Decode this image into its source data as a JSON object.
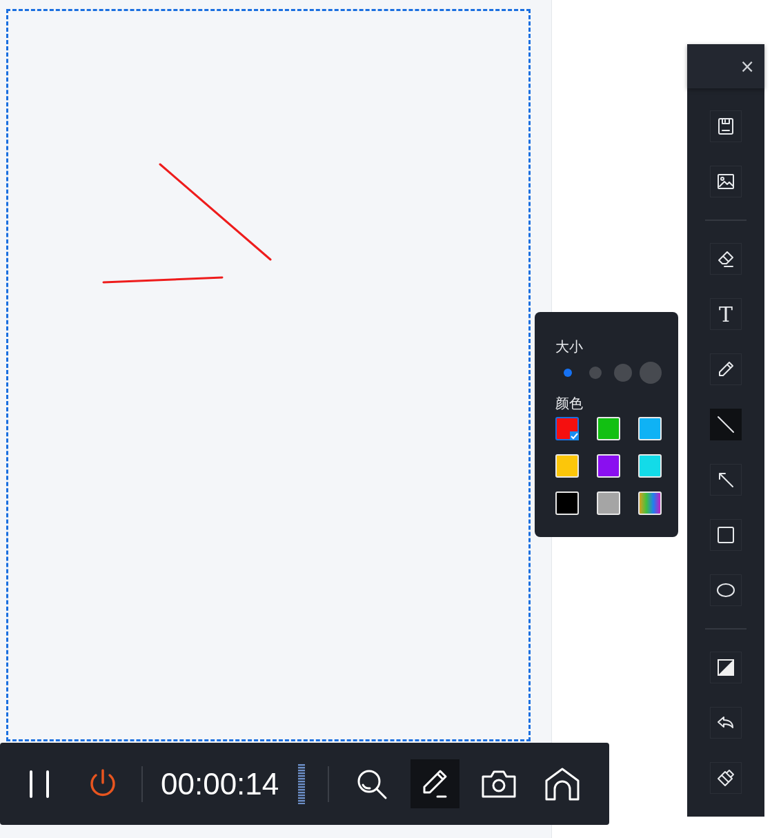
{
  "canvas": {
    "strokes": [
      {
        "kind": "line"
      },
      {
        "kind": "line"
      }
    ]
  },
  "side_toolbar": {
    "close": "×",
    "items": [
      {
        "kind": "save",
        "selected": false
      },
      {
        "kind": "image",
        "selected": false
      },
      {
        "kind": "divider"
      },
      {
        "kind": "eraser",
        "selected": false
      },
      {
        "kind": "text",
        "label": "T",
        "selected": false
      },
      {
        "kind": "pen",
        "selected": false
      },
      {
        "kind": "line",
        "selected": true
      },
      {
        "kind": "arrow",
        "selected": false
      },
      {
        "kind": "rect",
        "selected": false
      },
      {
        "kind": "ellipse",
        "selected": false
      },
      {
        "kind": "divider"
      },
      {
        "kind": "fill",
        "selected": false
      },
      {
        "kind": "undo",
        "selected": false
      },
      {
        "kind": "clear",
        "selected": false
      }
    ]
  },
  "style_popup": {
    "size_label": "大小",
    "sizes": [
      {
        "selected": true
      },
      {
        "selected": false
      },
      {
        "selected": false
      },
      {
        "selected": false
      }
    ],
    "color_label": "颜色",
    "colors": [
      {
        "kind": "solid",
        "color": "#f50f0f",
        "selected": true
      },
      {
        "kind": "solid",
        "color": "#12c012",
        "selected": false
      },
      {
        "kind": "solid",
        "color": "#0fb2f5",
        "selected": false
      },
      {
        "kind": "solid",
        "color": "#fcc60a",
        "selected": false
      },
      {
        "kind": "solid",
        "color": "#8a0ff0",
        "selected": false
      },
      {
        "kind": "solid",
        "color": "#13dbe8",
        "selected": false
      },
      {
        "kind": "solid",
        "color": "#000000",
        "selected": false
      },
      {
        "kind": "solid",
        "color": "#a5a5a5",
        "selected": false
      },
      {
        "kind": "spectrum",
        "selected": false
      }
    ]
  },
  "record_bar": {
    "items": [
      {
        "kind": "pause",
        "selected": false
      },
      {
        "kind": "stop",
        "selected": false
      },
      {
        "kind": "divider"
      },
      {
        "kind": "timer",
        "text": "00:00:14"
      },
      {
        "kind": "meter"
      },
      {
        "kind": "divider"
      },
      {
        "kind": "zoom",
        "selected": false
      },
      {
        "kind": "draw",
        "selected": true
      },
      {
        "kind": "camera",
        "selected": false
      },
      {
        "kind": "home",
        "selected": false
      }
    ]
  }
}
